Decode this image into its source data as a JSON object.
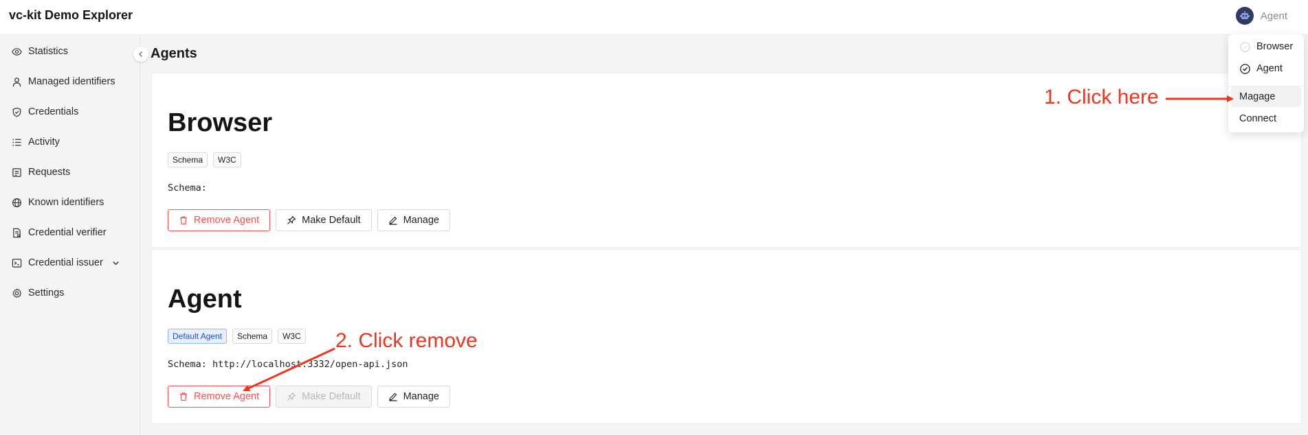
{
  "header": {
    "app_title": "vc-kit Demo Explorer",
    "user_name": "Agent"
  },
  "sidebar": {
    "items": [
      {
        "label": "Statistics",
        "icon": "eye-icon"
      },
      {
        "label": "Managed identifiers",
        "icon": "user-icon"
      },
      {
        "label": "Credentials",
        "icon": "shield-check-icon"
      },
      {
        "label": "Activity",
        "icon": "list-icon"
      },
      {
        "label": "Requests",
        "icon": "form-icon"
      },
      {
        "label": "Known identifiers",
        "icon": "globe-icon"
      },
      {
        "label": "Credential verifier",
        "icon": "file-check-icon"
      },
      {
        "label": "Credential issuer",
        "icon": "terminal-icon"
      },
      {
        "label": "Settings",
        "icon": "gear-icon"
      }
    ]
  },
  "main": {
    "page_title": "Agents",
    "cards": [
      {
        "title": "Browser",
        "tags": [
          "Schema",
          "W3C"
        ],
        "schema_text": "Schema:",
        "remove_label": "Remove Agent",
        "default_label": "Make Default",
        "manage_label": "Manage"
      },
      {
        "title": "Agent",
        "default_tag": "Default Agent",
        "tags": [
          "Schema",
          "W3C"
        ],
        "schema_text": "Schema: http://localhost:3332/open-api.json",
        "remove_label": "Remove Agent",
        "default_label": "Make Default",
        "manage_label": "Manage"
      }
    ]
  },
  "dropdown": {
    "items": [
      "Browser",
      "Agent",
      "Magage",
      "Connect"
    ]
  },
  "annotations": {
    "step1": "1. Click here",
    "step2": "2. Click remove",
    "color": "#f0341e"
  },
  "colors": {
    "danger": "#ff4d4f",
    "default_tag": "#1d4fd1",
    "avatar": "#2e3b63"
  }
}
